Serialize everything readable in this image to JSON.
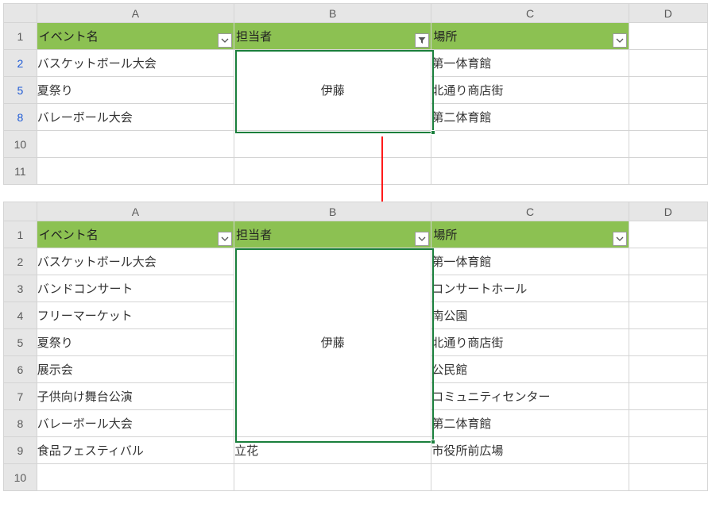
{
  "columns": [
    "A",
    "B",
    "C",
    "D"
  ],
  "headers": {
    "event": "イベント名",
    "person": "担当者",
    "place": "場所"
  },
  "grid_top": {
    "rows": [
      {
        "num": "1",
        "event": "イベント名",
        "person": "担当者",
        "place": "場所",
        "is_header": true
      },
      {
        "num": "2",
        "event": "バスケットボール大会",
        "place": "第一体育館",
        "filtered": true
      },
      {
        "num": "5",
        "event": "夏祭り",
        "place": "北通り商店街",
        "filtered": true
      },
      {
        "num": "8",
        "event": "バレーボール大会",
        "place": "第二体育館",
        "filtered": true
      },
      {
        "num": "10"
      },
      {
        "num": "11"
      }
    ],
    "merged_person_value": "伊藤",
    "column_b_filter_active": true
  },
  "grid_bottom": {
    "rows": [
      {
        "num": "1",
        "event": "イベント名",
        "person": "担当者",
        "place": "場所",
        "is_header": true
      },
      {
        "num": "2",
        "event": "バスケットボール大会",
        "place": "第一体育館"
      },
      {
        "num": "3",
        "event": "バンドコンサート",
        "place": "コンサートホール"
      },
      {
        "num": "4",
        "event": "フリーマーケット",
        "place": "南公園"
      },
      {
        "num": "5",
        "event": "夏祭り",
        "place": "北通り商店街"
      },
      {
        "num": "6",
        "event": "展示会",
        "place": "公民館"
      },
      {
        "num": "7",
        "event": "子供向け舞台公演",
        "place": "コミュニティセンター"
      },
      {
        "num": "8",
        "event": "バレーボール大会",
        "place": "第二体育館"
      },
      {
        "num": "9",
        "event": "食品フェスティバル",
        "person": "立花",
        "place": "市役所前広場"
      },
      {
        "num": "10"
      }
    ],
    "merged_person_value": "伊藤",
    "column_b_filter_active": false
  },
  "colors": {
    "header_green": "#8cc152",
    "selection_green": "#1a7f3c",
    "arrow_red": "#ff0000"
  }
}
